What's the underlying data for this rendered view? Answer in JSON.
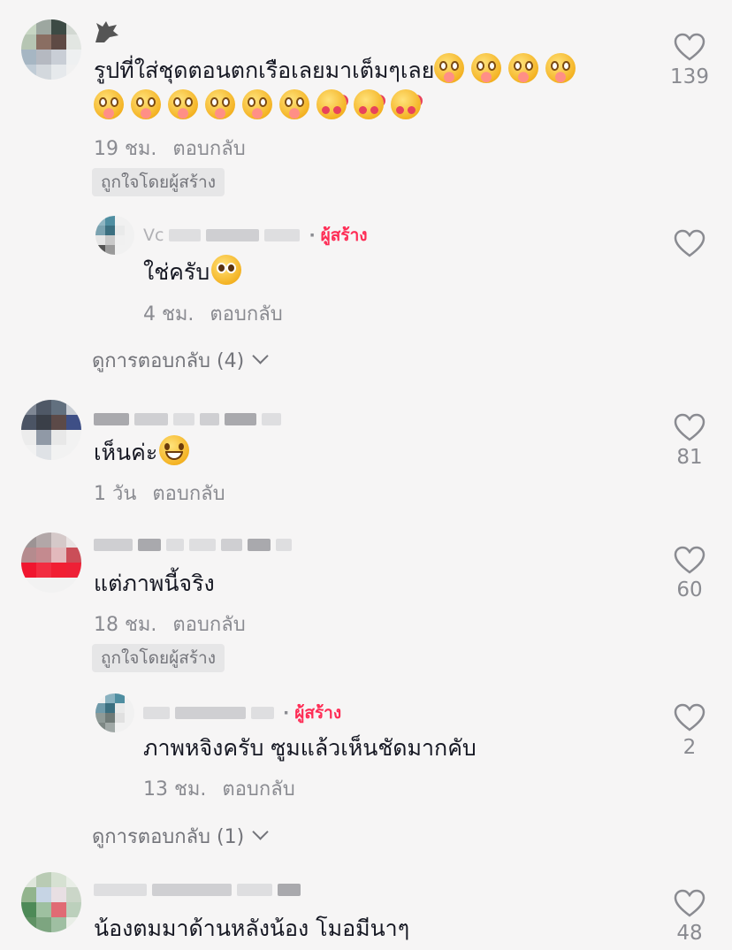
{
  "comments": [
    {
      "text": "รูปที่ใส่ชุดตอนตกเรือเลยมาเต็มๆเลย",
      "text_line2": "",
      "time": "19 ชม.",
      "reply_label": "ตอบกลับ",
      "badge": "ถูกใจโดยผู้สร้าง",
      "likes": "139",
      "replies": [
        {
          "name_visible": "Vc",
          "creator_label": "ผู้สร้าง",
          "text": "ใช่ครับ",
          "time": "4 ชม.",
          "reply_label": "ตอบกลับ",
          "likes": ""
        }
      ],
      "view_replies": "ดูการตอบกลับ (4)"
    },
    {
      "text": "เห็นค่ะ",
      "time": "1 วัน",
      "reply_label": "ตอบกลับ",
      "likes": "81"
    },
    {
      "text": "แต่ภาพนี้จริง",
      "time": "18 ชม.",
      "reply_label": "ตอบกลับ",
      "badge": "ถูกใจโดยผู้สร้าง",
      "likes": "60",
      "replies": [
        {
          "creator_label": "ผู้สร้าง",
          "text": "ภาพหจิงครับ ซูมแล้วเห็นชัดมากคับ",
          "time": "13 ชม.",
          "reply_label": "ตอบกลับ",
          "likes": "2"
        }
      ],
      "view_replies": "ดูการตอบกลับ (1)"
    },
    {
      "text": "น้องตมมาด้านหลังน้อง โมอมีนาๆ",
      "likes": "48"
    }
  ],
  "icons": {
    "like": "heart-outline-icon",
    "expand": "chevron-down-icon",
    "emoji": "emoji-icon"
  },
  "colors": {
    "creator_accent": "#fe2c55",
    "meta_gray": "#8a8b91",
    "background": "#f6f5f5"
  }
}
